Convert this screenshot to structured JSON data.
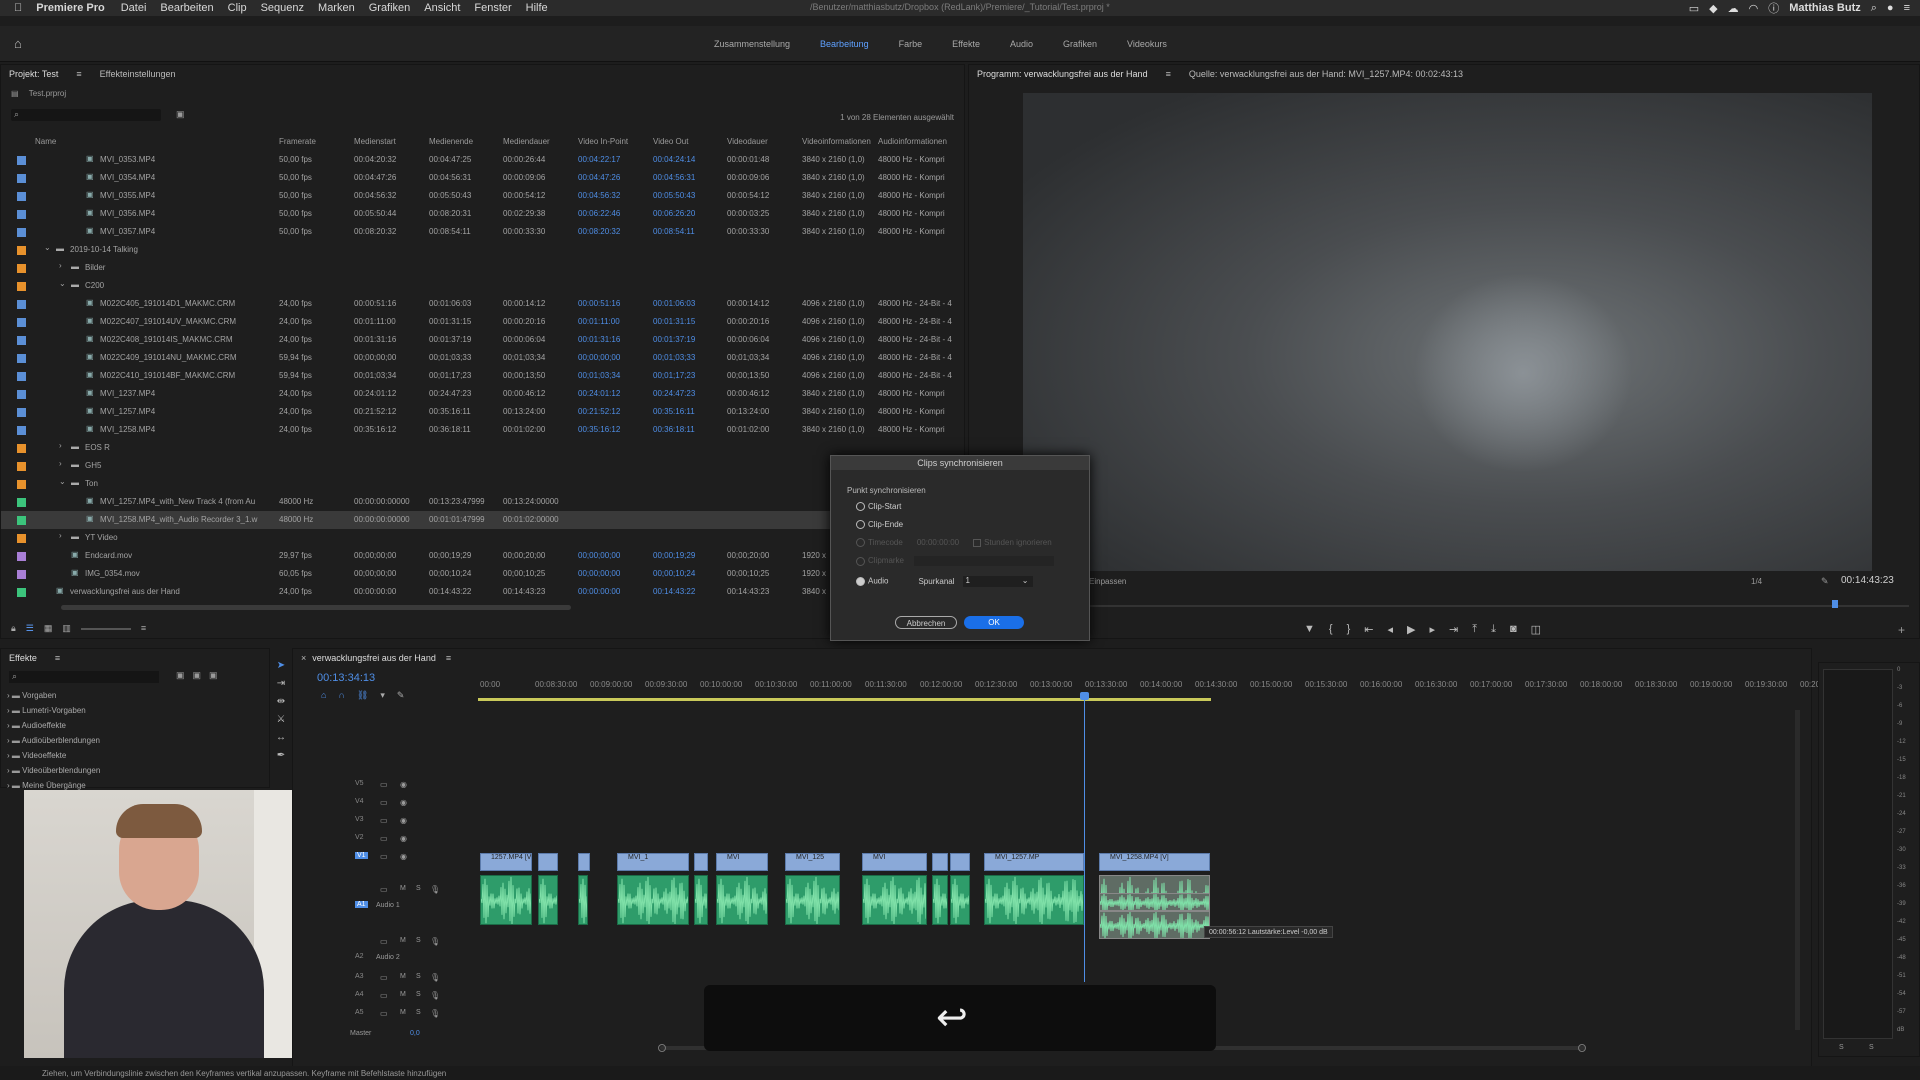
{
  "menubar": {
    "apple": "",
    "app": "Premiere Pro",
    "items": [
      "Datei",
      "Bearbeiten",
      "Clip",
      "Sequenz",
      "Marken",
      "Grafiken",
      "Ansicht",
      "Fenster",
      "Hilfe"
    ],
    "user": "Matthias Butz",
    "window_title": "/Benutzer/matthiasbutz/Dropbox (RedLank)/Premiere/_Tutorial/Test.prproj *"
  },
  "workspaces": {
    "tabs": [
      "Zusammenstellung",
      "Bearbeitung",
      "Farbe",
      "Effekte",
      "Audio",
      "Grafiken",
      "Videokurs"
    ],
    "active": "Bearbeitung"
  },
  "project_panel": {
    "tab_project": "Projekt: Test",
    "tab_effects": "Effekteinstellungen",
    "file": "Test.prproj",
    "selection_info": "1 von 28 Elementen ausgewählt",
    "columns": [
      "Name",
      "Framerate",
      "Medienstart",
      "Medienende",
      "Mediendauer",
      "Video In-Point",
      "Video Out",
      "Videodauer",
      "Videoinformationen",
      "Audioinformationen"
    ],
    "rows": [
      {
        "color": "#5b8fd6",
        "indent": 3,
        "name": "MVI_0353.MP4",
        "fps": "50,00 fps",
        "start": "00:04:20:32",
        "end": "00:04:47:25",
        "dur": "00:00:26:44",
        "in": "00:04:22:17",
        "out": "00:04:24:14",
        "vdur": "00:00:01:48",
        "vinfo": "3840 x 2160 (1,0)",
        "ainfo": "48000 Hz - Kompri"
      },
      {
        "color": "#5b8fd6",
        "indent": 3,
        "name": "MVI_0354.MP4",
        "fps": "50,00 fps",
        "start": "00:04:47:26",
        "end": "00:04:56:31",
        "dur": "00:00:09:06",
        "in": "00:04:47:26",
        "out": "00:04:56:31",
        "vdur": "00:00:09:06",
        "vinfo": "3840 x 2160 (1,0)",
        "ainfo": "48000 Hz - Kompri"
      },
      {
        "color": "#5b8fd6",
        "indent": 3,
        "name": "MVI_0355.MP4",
        "fps": "50,00 fps",
        "start": "00:04:56:32",
        "end": "00:05:50:43",
        "dur": "00:00:54:12",
        "in": "00:04:56:32",
        "out": "00:05:50:43",
        "vdur": "00:00:54:12",
        "vinfo": "3840 x 2160 (1,0)",
        "ainfo": "48000 Hz - Kompri"
      },
      {
        "color": "#5b8fd6",
        "indent": 3,
        "name": "MVI_0356.MP4",
        "fps": "50,00 fps",
        "start": "00:05:50:44",
        "end": "00:08:20:31",
        "dur": "00:02:29:38",
        "in": "00:06:22:46",
        "out": "00:06:26:20",
        "vdur": "00:00:03:25",
        "vinfo": "3840 x 2160 (1,0)",
        "ainfo": "48000 Hz - Kompri"
      },
      {
        "color": "#5b8fd6",
        "indent": 3,
        "name": "MVI_0357.MP4",
        "fps": "50,00 fps",
        "start": "00:08:20:32",
        "end": "00:08:54:11",
        "dur": "00:00:33:30",
        "in": "00:08:20:32",
        "out": "00:08:54:11",
        "vdur": "00:00:33:30",
        "vinfo": "3840 x 2160 (1,0)",
        "ainfo": "48000 Hz - Kompri"
      },
      {
        "color": "#e8922c",
        "indent": 1,
        "folder": true,
        "open": true,
        "name": "2019-10-14 Talking",
        "fps": "",
        "start": "",
        "end": "",
        "dur": "",
        "in": "",
        "out": "",
        "vdur": "",
        "vinfo": "",
        "ainfo": ""
      },
      {
        "color": "#e8922c",
        "indent": 2,
        "folder": true,
        "name": "Bilder",
        "fps": "",
        "start": "",
        "end": "",
        "dur": "",
        "in": "",
        "out": "",
        "vdur": "",
        "vinfo": "",
        "ainfo": ""
      },
      {
        "color": "#e8922c",
        "indent": 2,
        "folder": true,
        "open": true,
        "name": "C200",
        "fps": "",
        "start": "",
        "end": "",
        "dur": "",
        "in": "",
        "out": "",
        "vdur": "",
        "vinfo": "",
        "ainfo": ""
      },
      {
        "color": "#5b8fd6",
        "indent": 3,
        "name": "M022C405_191014D1_MAKMC.CRM",
        "fps": "24,00 fps",
        "start": "00:00:51:16",
        "end": "00:01:06:03",
        "dur": "00:00:14:12",
        "in": "00:00:51:16",
        "out": "00:01:06:03",
        "vdur": "00:00:14:12",
        "vinfo": "4096 x 2160 (1,0)",
        "ainfo": "48000 Hz - 24-Bit - 4"
      },
      {
        "color": "#5b8fd6",
        "indent": 3,
        "name": "M022C407_191014UV_MAKMC.CRM",
        "fps": "24,00 fps",
        "start": "00:01:11:00",
        "end": "00:01:31:15",
        "dur": "00:00:20:16",
        "in": "00:01:11:00",
        "out": "00:01:31:15",
        "vdur": "00:00:20:16",
        "vinfo": "4096 x 2160 (1,0)",
        "ainfo": "48000 Hz - 24-Bit - 4"
      },
      {
        "color": "#5b8fd6",
        "indent": 3,
        "name": "M022C408_191014IS_MAKMC.CRM",
        "fps": "24,00 fps",
        "start": "00:01:31:16",
        "end": "00:01:37:19",
        "dur": "00:00:06:04",
        "in": "00:01:31:16",
        "out": "00:01:37:19",
        "vdur": "00:00:06:04",
        "vinfo": "4096 x 2160 (1,0)",
        "ainfo": "48000 Hz - 24-Bit - 4"
      },
      {
        "color": "#5b8fd6",
        "indent": 3,
        "name": "M022C409_191014NU_MAKMC.CRM",
        "fps": "59,94 fps",
        "start": "00;00;00;00",
        "end": "00;01;03;33",
        "dur": "00;01;03;34",
        "in": "00;00;00;00",
        "out": "00;01;03;33",
        "vdur": "00;01;03;34",
        "vinfo": "4096 x 2160 (1,0)",
        "ainfo": "48000 Hz - 24-Bit - 4"
      },
      {
        "color": "#5b8fd6",
        "indent": 3,
        "name": "M022C410_191014BF_MAKMC.CRM",
        "fps": "59,94 fps",
        "start": "00;01;03;34",
        "end": "00;01;17;23",
        "dur": "00;00;13;50",
        "in": "00;01;03;34",
        "out": "00;01;17;23",
        "vdur": "00;00;13;50",
        "vinfo": "4096 x 2160 (1,0)",
        "ainfo": "48000 Hz - 24-Bit - 4"
      },
      {
        "color": "#5b8fd6",
        "indent": 3,
        "name": "MVI_1237.MP4",
        "fps": "24,00 fps",
        "start": "00:24:01:12",
        "end": "00:24:47:23",
        "dur": "00:00:46:12",
        "in": "00:24:01:12",
        "out": "00:24:47:23",
        "vdur": "00:00:46:12",
        "vinfo": "3840 x 2160 (1,0)",
        "ainfo": "48000 Hz - Kompri"
      },
      {
        "color": "#5b8fd6",
        "indent": 3,
        "name": "MVI_1257.MP4",
        "fps": "24,00 fps",
        "start": "00:21:52:12",
        "end": "00:35:16:11",
        "dur": "00:13:24:00",
        "in": "00:21:52:12",
        "out": "00:35:16:11",
        "vdur": "00:13:24:00",
        "vinfo": "3840 x 2160 (1,0)",
        "ainfo": "48000 Hz - Kompri"
      },
      {
        "color": "#5b8fd6",
        "indent": 3,
        "name": "MVI_1258.MP4",
        "fps": "24,00 fps",
        "start": "00:35:16:12",
        "end": "00:36:18:11",
        "dur": "00:01:02:00",
        "in": "00:35:16:12",
        "out": "00:36:18:11",
        "vdur": "00:01:02:00",
        "vinfo": "3840 x 2160 (1,0)",
        "ainfo": "48000 Hz - Kompri"
      },
      {
        "color": "#e8922c",
        "indent": 2,
        "folder": true,
        "name": "EOS R",
        "fps": "",
        "start": "",
        "end": "",
        "dur": "",
        "in": "",
        "out": "",
        "vdur": "",
        "vinfo": "",
        "ainfo": ""
      },
      {
        "color": "#e8922c",
        "indent": 2,
        "folder": true,
        "name": "GH5",
        "fps": "",
        "start": "",
        "end": "",
        "dur": "",
        "in": "",
        "out": "",
        "vdur": "",
        "vinfo": "",
        "ainfo": ""
      },
      {
        "color": "#e8922c",
        "indent": 2,
        "folder": true,
        "open": true,
        "name": "Ton",
        "fps": "",
        "start": "",
        "end": "",
        "dur": "",
        "in": "",
        "out": "",
        "vdur": "",
        "vinfo": "",
        "ainfo": ""
      },
      {
        "color": "#3cc47c",
        "indent": 3,
        "name": "MVI_1257.MP4_with_New Track 4 (from Au",
        "fps": "48000  Hz",
        "start": "00:00:00:00000",
        "end": "00:13:23:47999",
        "dur": "00:13:24:00000",
        "in": "",
        "out": "",
        "vdur": "",
        "vinfo": "",
        "ainfo": ""
      },
      {
        "color": "#3cc47c",
        "indent": 3,
        "selected": true,
        "name": "MVI_1258.MP4_with_Audio Recorder 3_1.w",
        "fps": "48000  Hz",
        "start": "00:00:00:00000",
        "end": "00:01:01:47999",
        "dur": "00:01:02:00000",
        "in": "",
        "out": "",
        "vdur": "",
        "vinfo": "",
        "ainfo": ""
      },
      {
        "color": "#e8922c",
        "indent": 2,
        "folder": true,
        "name": "YT Video",
        "fps": "",
        "start": "",
        "end": "",
        "dur": "",
        "in": "",
        "out": "",
        "vdur": "",
        "vinfo": "",
        "ainfo": ""
      },
      {
        "color": "#a97fd6",
        "indent": 2,
        "name": "Endcard.mov",
        "fps": "29,97 fps",
        "start": "00;00;00;00",
        "end": "00;00;19;29",
        "dur": "00;00;20;00",
        "in": "00;00;00;00",
        "out": "00;00;19;29",
        "vdur": "00;00;20;00",
        "vinfo": "1920 x",
        "ainfo": ""
      },
      {
        "color": "#a97fd6",
        "indent": 2,
        "name": "IMG_0354.mov",
        "fps": "60,05 fps",
        "start": "00;00;00;00",
        "end": "00;00;10;24",
        "dur": "00;00;10;25",
        "in": "00;00;00;00",
        "out": "00;00;10;24",
        "vdur": "00;00;10;25",
        "vinfo": "1920 x",
        "ainfo": ""
      },
      {
        "color": "#3cc47c",
        "indent": 1,
        "seq": true,
        "name": "verwacklungsfrei aus der Hand",
        "fps": "24,00 fps",
        "start": "00:00:00:00",
        "end": "00:14:43:22",
        "dur": "00:14:43:23",
        "in": "00:00:00:00",
        "out": "00:14:43:22",
        "vdur": "00:14:43:23",
        "vinfo": "3840 x",
        "ainfo": ""
      }
    ]
  },
  "program_monitor": {
    "tab": "Programm: verwacklungsfrei aus der Hand",
    "source": "Quelle: verwacklungsfrei aus der Hand: MVI_1257.MP4: 00:02:43:13",
    "zoom": "1/4",
    "timecode": "00:14:43:23",
    "fit": "Einpassen"
  },
  "dialog": {
    "title": "Clips synchronisieren",
    "section": "Punkt synchronisieren",
    "options": [
      "Clip-Start",
      "Clip-Ende",
      "Timecode",
      "Clipmarke",
      "Audio"
    ],
    "timecode_value": "00:00:00:00",
    "ignore_hours": "Stunden ignorieren",
    "track_label": "Spurkanal",
    "track_value": "1",
    "cancel": "Abbrechen",
    "ok": "OK"
  },
  "effects_panel": {
    "title": "Effekte",
    "items": [
      "Vorgaben",
      "Lumetri-Vorgaben",
      "Audioeffekte",
      "Audioüberblendungen",
      "Videoeffekte",
      "Videoüberblendungen",
      "Meine Übergänge"
    ]
  },
  "timeline": {
    "tab": "verwacklungsfrei aus der Hand",
    "timecode": "00:13:34:13",
    "ruler": [
      "00:00",
      "00:08:30:00",
      "00:09:00:00",
      "00:09:30:00",
      "00:10:00:00",
      "00:10:30:00",
      "00:11:00:00",
      "00:11:30:00",
      "00:12:00:00",
      "00:12:30:00",
      "00:13:00:00",
      "00:13:30:00",
      "00:14:00:00",
      "00:14:30:00",
      "00:15:00:00",
      "00:15:30:00",
      "00:16:00:00",
      "00:16:30:00",
      "00:17:00:00",
      "00:17:30:00",
      "00:18:00:00",
      "00:18:30:00",
      "00:19:00:00",
      "00:19:30:00",
      "00:20:0"
    ],
    "video_tracks": [
      "V5",
      "V4",
      "V3",
      "V2",
      "V1"
    ],
    "audio_tracks": [
      "A1",
      "A2",
      "A3",
      "A4",
      "A5"
    ],
    "audio_names": [
      "Audio 1",
      "Audio 2"
    ],
    "master": "Master",
    "master_value": "0,0",
    "clips_v": [
      "1257.MP4 [V]",
      "MVI_1",
      "MVI",
      "MVI_125",
      "MVI",
      "MVI_1257.MP",
      "MVI_1258.MP4 [V]"
    ],
    "tooltip": "00:00:56:12  Lautstärke:Level  -0,00 dB"
  },
  "meter_labels": [
    "0",
    "-3",
    "-6",
    "-9",
    "-12",
    "-15",
    "-18",
    "-21",
    "-24",
    "-27",
    "-30",
    "-33",
    "-36",
    "-39",
    "-42",
    "-45",
    "-48",
    "-51",
    "-54",
    "-57",
    "dB"
  ],
  "meter_solo": [
    "S",
    "S"
  ],
  "status": "Ziehen, um Verbindungslinie zwischen den Keyframes vertikal anzupassen. Keyframe mit Befehlstaste hinzufügen"
}
